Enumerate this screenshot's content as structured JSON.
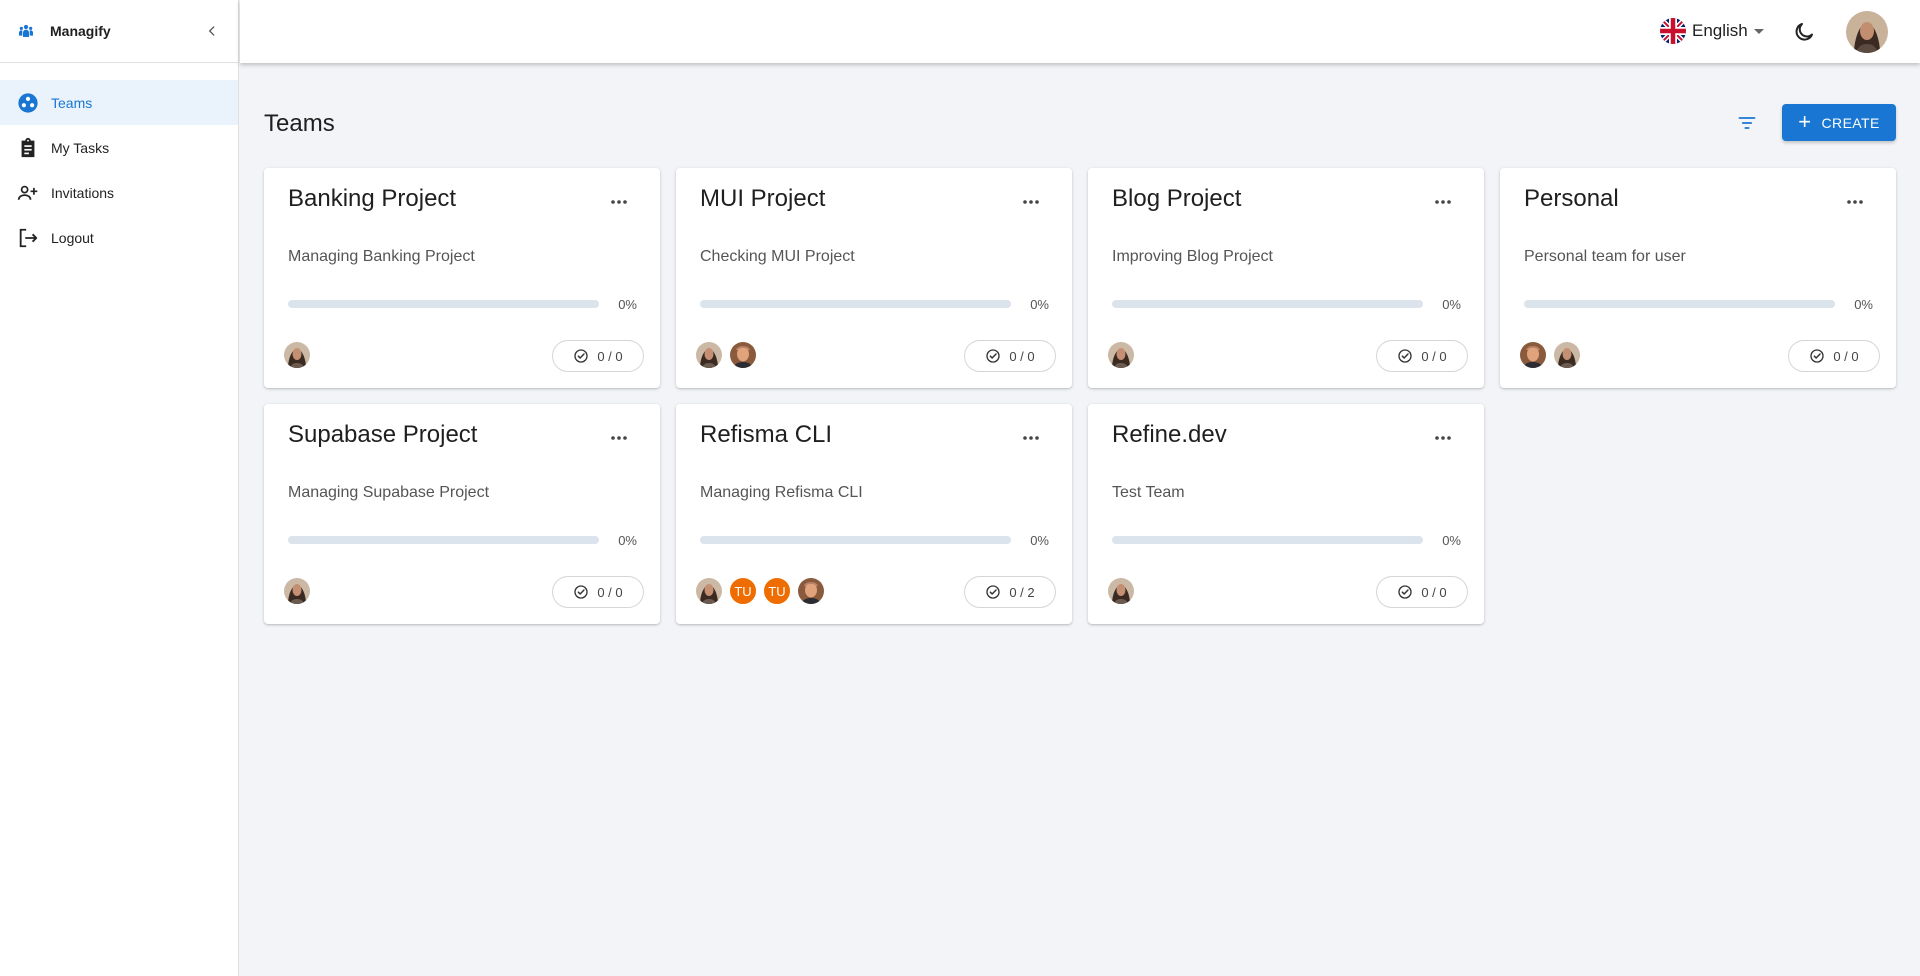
{
  "app": {
    "name": "Managify"
  },
  "sidebar": {
    "items": [
      {
        "label": "Teams",
        "icon": "teams-icon",
        "active": true
      },
      {
        "label": "My Tasks",
        "icon": "clipboard-icon",
        "active": false
      },
      {
        "label": "Invitations",
        "icon": "person-add-icon",
        "active": false
      },
      {
        "label": "Logout",
        "icon": "logout-icon",
        "active": false
      }
    ]
  },
  "topbar": {
    "language": "English",
    "language_flag": "uk-flag-icon",
    "theme_icon": "moon-icon",
    "user_avatar": "user-avatar"
  },
  "page": {
    "title": "Teams",
    "create_label": "CREATE"
  },
  "colors": {
    "accent": "#1976d2",
    "initials_avatar": "#ef6c00",
    "active_menu_bg": "#eaf2fb"
  },
  "teams": [
    {
      "title": "Banking Project",
      "description": "Managing Banking Project",
      "progress_pct": "0%",
      "progress": 0,
      "tasks": "0 / 0",
      "members": [
        {
          "type": "photo",
          "variant": "woman"
        }
      ]
    },
    {
      "title": "MUI Project",
      "description": "Checking MUI Project",
      "progress_pct": "0%",
      "progress": 0,
      "tasks": "0 / 0",
      "members": [
        {
          "type": "photo",
          "variant": "woman"
        },
        {
          "type": "photo",
          "variant": "man"
        }
      ]
    },
    {
      "title": "Blog Project",
      "description": "Improving Blog Project",
      "progress_pct": "0%",
      "progress": 0,
      "tasks": "0 / 0",
      "members": [
        {
          "type": "photo",
          "variant": "woman"
        }
      ]
    },
    {
      "title": "Personal",
      "description": "Personal team for user",
      "progress_pct": "0%",
      "progress": 0,
      "tasks": "0 / 0",
      "members": [
        {
          "type": "photo",
          "variant": "man"
        },
        {
          "type": "photo",
          "variant": "woman"
        }
      ]
    },
    {
      "title": "Supabase Project",
      "description": "Managing Supabase Project",
      "progress_pct": "0%",
      "progress": 0,
      "tasks": "0 / 0",
      "members": [
        {
          "type": "photo",
          "variant": "woman"
        }
      ]
    },
    {
      "title": "Refisma CLI",
      "description": "Managing Refisma CLI",
      "progress_pct": "0%",
      "progress": 0,
      "tasks": "0 / 2",
      "members": [
        {
          "type": "photo",
          "variant": "woman"
        },
        {
          "type": "initials",
          "text": "TU"
        },
        {
          "type": "initials",
          "text": "TU"
        },
        {
          "type": "photo",
          "variant": "man"
        }
      ]
    },
    {
      "title": "Refine.dev",
      "description": "Test Team",
      "progress_pct": "0%",
      "progress": 0,
      "tasks": "0 / 0",
      "members": [
        {
          "type": "photo",
          "variant": "woman"
        }
      ]
    }
  ]
}
